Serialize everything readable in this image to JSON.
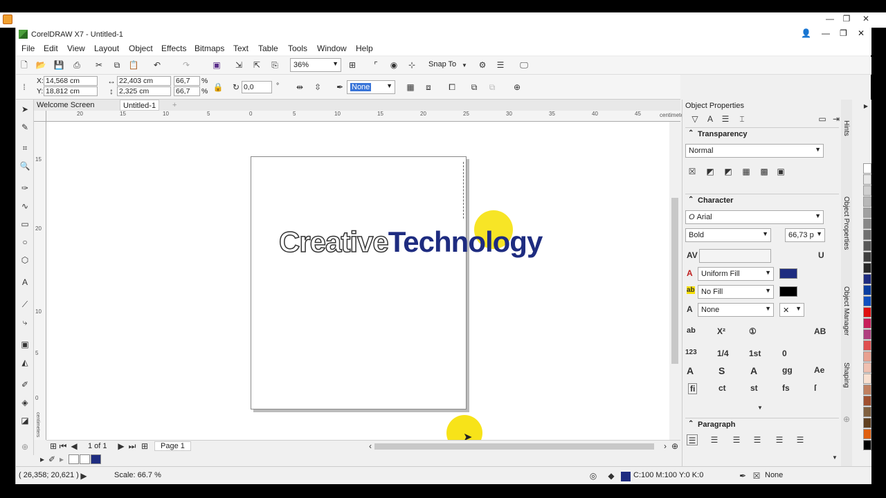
{
  "window": {
    "title": "CorelDRAW X7 - Untitled-1"
  },
  "outer_controls": {
    "minimize": "—",
    "restore": "❐",
    "close": "✕"
  },
  "menu": [
    "File",
    "Edit",
    "View",
    "Layout",
    "Object",
    "Effects",
    "Bitmaps",
    "Text",
    "Table",
    "Tools",
    "Window",
    "Help"
  ],
  "toolbar": {
    "zoom": "36%",
    "snap_to": "Snap To"
  },
  "property_bar": {
    "x_label": "X:",
    "x_value": "14,568 cm",
    "y_label": "Y:",
    "y_value": "18,812 cm",
    "width_value": "22,403 cm",
    "height_value": "2,325 cm",
    "scale_w": "66,7",
    "scale_h": "66,7",
    "pct": "%",
    "angle": "0,0",
    "deg": "°",
    "outline": "None"
  },
  "doc_tabs": [
    "Welcome Screen",
    "Untitled-1"
  ],
  "ruler": {
    "h_labels": [
      "20",
      "15",
      "10",
      "5",
      "0",
      "5",
      "10",
      "15",
      "20",
      "25",
      "30",
      "35",
      "40",
      "45"
    ],
    "unit": "centimeters",
    "v_unit": "centimeters",
    "v_labels": [
      "15",
      "20",
      "10",
      "5",
      "0"
    ]
  },
  "canvas": {
    "text_part1": "Creative",
    "text_part2": "Technology"
  },
  "page_nav": {
    "count": "1 of 1",
    "page_tab": "Page 1"
  },
  "status": {
    "coords": "( 26,358; 20,621 )",
    "scale": "Scale: 66.7 %",
    "fill": "C:100 M:100 Y:0 K:0",
    "outline": "None"
  },
  "docker": {
    "title": "Object Properties",
    "transparency": {
      "title": "Transparency",
      "mode": "Normal"
    },
    "character": {
      "title": "Character",
      "font": "Arial",
      "style": "Bold",
      "size": "66,73 p",
      "fill_type": "Uniform Fill",
      "bg_fill": "No Fill",
      "outline": "None"
    },
    "paragraph": {
      "title": "Paragraph"
    },
    "glyphs": [
      "ab",
      "X²",
      "①",
      "AB",
      "123",
      "1/4",
      "1st",
      "0",
      "A",
      "S",
      "A",
      "gg",
      "Ae",
      "fi",
      "ct",
      "st",
      "fs",
      "ſ"
    ]
  },
  "side_tabs": [
    "Hints",
    "Object Properties",
    "Object Manager",
    "Shaping"
  ],
  "colors": {
    "accent_blue": "#1e2c80",
    "palette": [
      "#ffffff",
      "#e8e8e8",
      "#d0d0d0",
      "#b8b8b8",
      "#a0a0a0",
      "#888888",
      "#707070",
      "#585858",
      "#404040",
      "#282828",
      "#1e2c80",
      "#0a3ea0",
      "#1050c0",
      "#e01010",
      "#c81e5a",
      "#b04080",
      "#e05050",
      "#e8a090",
      "#f0c0b0",
      "#f8e0d0",
      "#c08060",
      "#a05030",
      "#806040",
      "#604020",
      "#e06010",
      "#000000"
    ]
  }
}
